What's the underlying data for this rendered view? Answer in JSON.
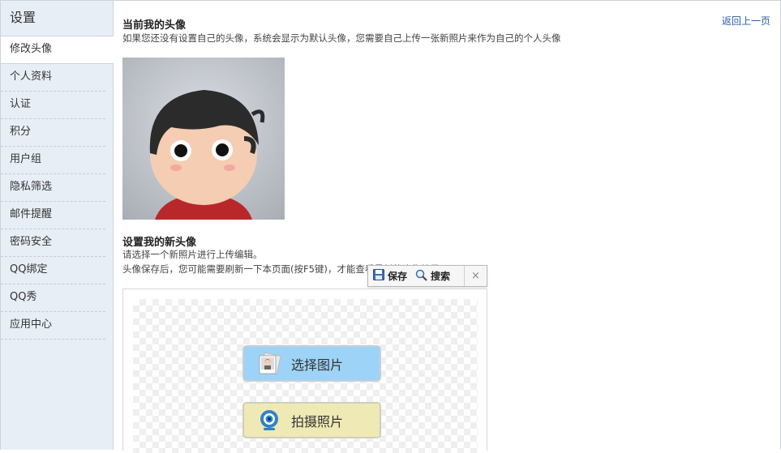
{
  "sidebar": {
    "title": "设置",
    "items": [
      {
        "label": "修改头像",
        "active": true
      },
      {
        "label": "个人资料"
      },
      {
        "label": "认证"
      },
      {
        "label": "积分"
      },
      {
        "label": "用户组"
      },
      {
        "label": "隐私筛选"
      },
      {
        "label": "邮件提醒"
      },
      {
        "label": "密码安全"
      },
      {
        "label": "QQ绑定"
      },
      {
        "label": "QQ秀"
      },
      {
        "label": "应用中心"
      }
    ]
  },
  "main": {
    "back_link": "返回上一页",
    "current": {
      "title": "当前我的头像",
      "desc": "如果您还没有设置自己的头像，系统会显示为默认头像，您需要自己上传一张新照片来作为自己的个人头像"
    },
    "new_avatar": {
      "title": "设置我的新头像",
      "line1": "请选择一个新照片进行上传编辑。",
      "line2": "头像保存后，您可能需要刷新一下本页面(按F5键)，才能查看最新的头像效果"
    },
    "toolbar": {
      "save_label": "保存",
      "search_label": "搜索",
      "close_label": "×"
    },
    "upload": {
      "select_label": "选择图片",
      "photo_label": "拍摄照片"
    }
  },
  "icons": {
    "save": "floppy-icon",
    "search": "magnifier-icon",
    "select": "photo-icon",
    "photo": "webcam-icon"
  },
  "colors": {
    "sidebar_bg": "#e8eef6",
    "link": "#2b5da9",
    "select_btn": "#9dd3f7",
    "photo_btn": "#efe9b5"
  }
}
